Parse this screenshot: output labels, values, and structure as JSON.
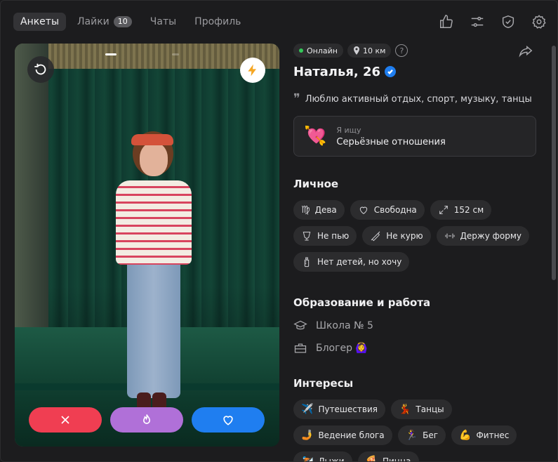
{
  "nav": {
    "tabs": [
      {
        "label": "Анкеты",
        "active": true
      },
      {
        "label": "Лайки",
        "badge": "10"
      },
      {
        "label": "Чаты"
      },
      {
        "label": "Профиль"
      }
    ],
    "icons": [
      "thumbs-up-icon",
      "sliders-icon",
      "shield-check-icon",
      "gear-icon"
    ]
  },
  "profile": {
    "status": "Онлайн",
    "distance": "10 км",
    "help": "?",
    "name": "Наталья, 26",
    "about": "Люблю активный отдых, спорт, музыку, танцы",
    "looking_for": {
      "label": "Я ищу",
      "value": "Серьёзные отношения",
      "emoji": "💘"
    }
  },
  "personal": {
    "title": "Личное",
    "chips": [
      {
        "icon": "virgo-icon",
        "label": "Дева"
      },
      {
        "icon": "heart-outline-icon",
        "label": "Свободна"
      },
      {
        "icon": "expand-icon",
        "label": "152 см"
      },
      {
        "icon": "glass-icon",
        "label": "Не пью"
      },
      {
        "icon": "no-smoking-icon",
        "label": "Не курю"
      },
      {
        "icon": "dumbbell-icon",
        "label": "Держу форму"
      },
      {
        "icon": "baby-bottle-icon",
        "label": "Нет детей, но хочу"
      }
    ]
  },
  "education": {
    "title": "Образование и работа",
    "school": "Школа № 5",
    "job": "Блогер 🙆‍♀️"
  },
  "interests": {
    "title": "Интересы",
    "chips": [
      {
        "emoji": "✈️",
        "label": "Путешествия"
      },
      {
        "emoji": "💃",
        "label": "Танцы"
      },
      {
        "emoji": "🤳",
        "label": "Ведение блога"
      },
      {
        "emoji": "🏃‍♀️",
        "label": "Бег"
      },
      {
        "emoji": "💪",
        "label": "Фитнес"
      },
      {
        "emoji": "⛷️",
        "label": "Лыжи"
      },
      {
        "emoji": "🍕",
        "label": "Пицца"
      }
    ]
  },
  "colors": {
    "dislike": "#f03e52",
    "superlike": "#b070d8",
    "like": "#1f7ef0",
    "online": "#34c759",
    "boost": "#f5a623"
  }
}
